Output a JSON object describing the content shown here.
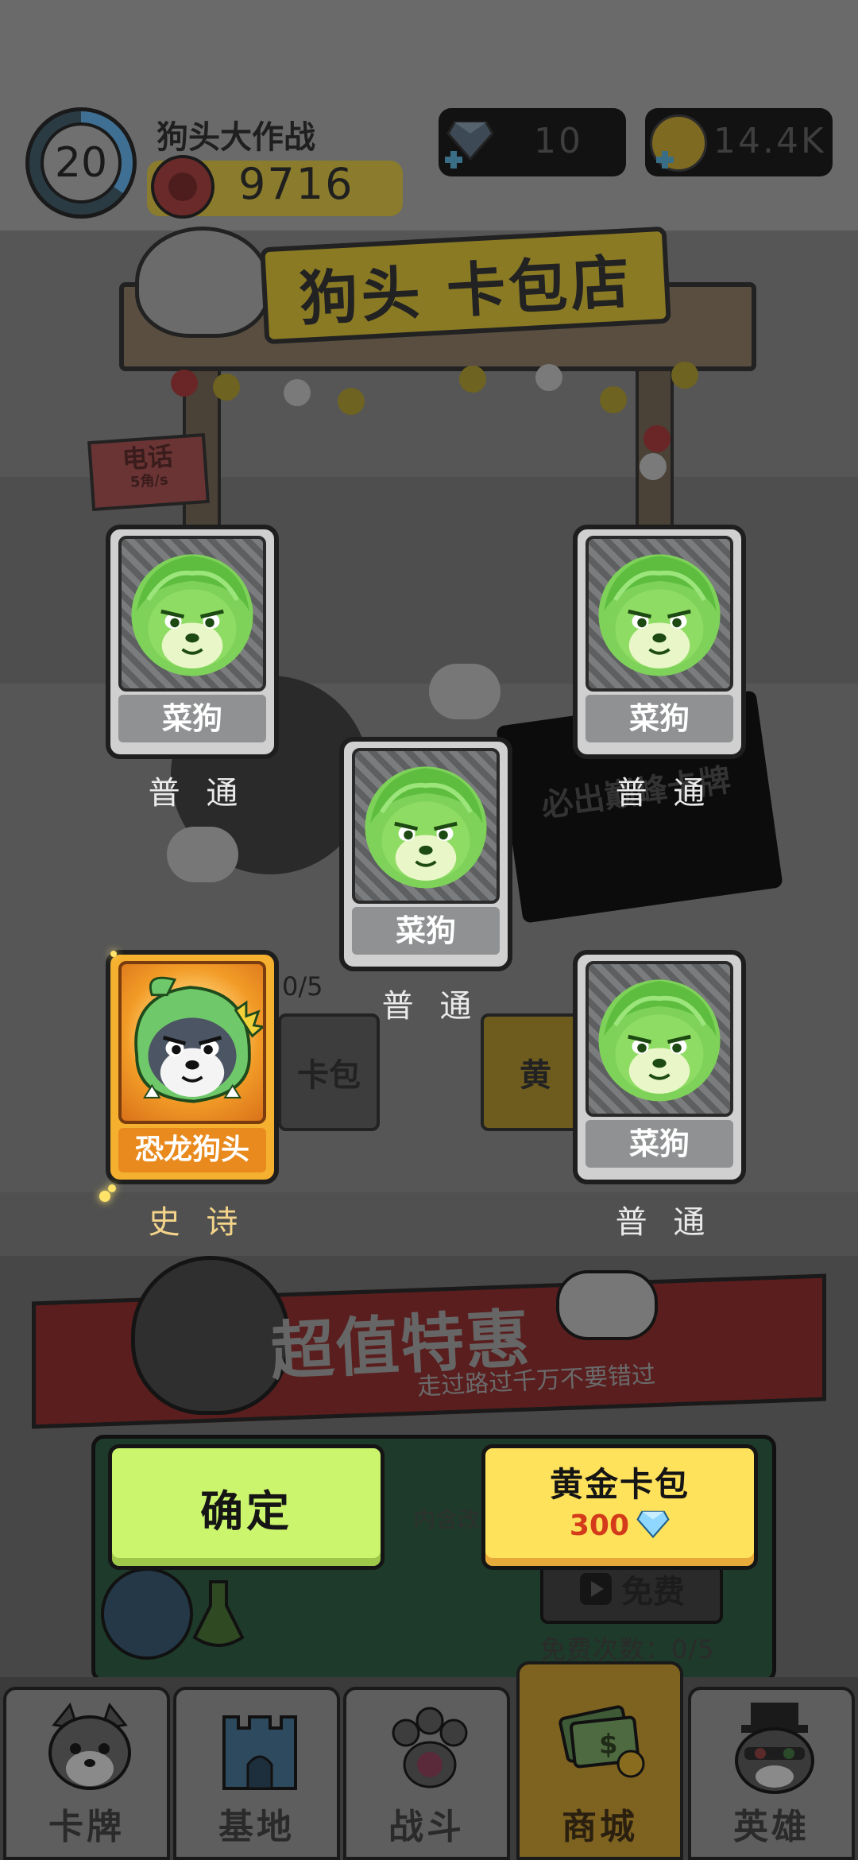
{
  "header": {
    "level": "20",
    "player_name": "狗头大作战",
    "red_currency": "9716",
    "diamonds": "10",
    "gold": "14.4K"
  },
  "background": {
    "shop_sign": "狗头 卡包店",
    "phone_sign": "电话",
    "phone_sign_sub": "5角/s",
    "banner_text": "必出巅峰卡牌",
    "pack_progress": "0/5",
    "button_left_partial": "卡包",
    "button_right_partial": "黄"
  },
  "cards": [
    {
      "name": "菜狗",
      "rarity": "普 通",
      "type": "normal"
    },
    {
      "name": "菜狗",
      "rarity": "普 通",
      "type": "normal"
    },
    {
      "name": "菜狗",
      "rarity": "普 通",
      "type": "normal"
    },
    {
      "name": "恐龙狗头",
      "rarity": "史 诗",
      "type": "epic"
    },
    {
      "name": "菜狗",
      "rarity": "普 通",
      "type": "normal"
    }
  ],
  "promo": {
    "title": "超值特惠",
    "subtitle": "走过路过千万不要错过",
    "hint": "内含改",
    "free_button": "免费",
    "free_count": "免费次数：0/5"
  },
  "buttons": {
    "confirm": "确定",
    "gold_pack": "黄金卡包",
    "gold_pack_price": "300"
  },
  "nav": [
    {
      "label": "卡牌",
      "icon": "dog-head-icon",
      "active": false
    },
    {
      "label": "基地",
      "icon": "castle-icon",
      "active": false
    },
    {
      "label": "战斗",
      "icon": "paw-icon",
      "active": false
    },
    {
      "label": "商城",
      "icon": "money-icon",
      "active": true
    },
    {
      "label": "英雄",
      "icon": "hero-dog-icon",
      "active": false
    }
  ],
  "colors": {
    "confirm_button": "#ccf56e",
    "gold_button": "#ffe25c",
    "price_text": "#d43b1a",
    "epic_card": "#f5b02f",
    "normal_card": "#cfd0cf"
  }
}
